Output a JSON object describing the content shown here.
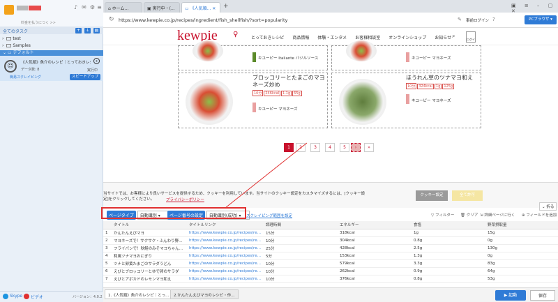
{
  "sidebar": {
    "subtitle": "料金を払うにつく >>",
    "task_header": "全てのタスク",
    "folders": [
      "test",
      "Samples"
    ],
    "default_folder": "デフォルト",
    "task": {
      "title": "《人気順》魚介のレシピ｜とっておきレシ...",
      "count_label": "データ数: 8",
      "status": "実行中",
      "mode": "簡易スクレイピング",
      "speed_button": "スピードアップ"
    },
    "footer": {
      "skype": "Skype",
      "video": "ビデオ",
      "version": "バージョン：4.0.2"
    }
  },
  "tabs": [
    {
      "label": "ホーム..."
    },
    {
      "label": "実行中・(..."
    },
    {
      "label": "《人気順..."
    }
  ],
  "url": "https://www.kewpie.co.jp/recipes/ingredient/fish_shellfish/?sort=popularity",
  "header_right": {
    "login": "事前ログイン",
    "browser": "PCブラウザ"
  },
  "site": {
    "logo": "kewpie",
    "nav": [
      "とっておきレシピ",
      "商品情報",
      "体験・エンタメ",
      "お客様相談室",
      "オンラインショップ",
      "お知らせ"
    ],
    "login": "ログイン",
    "cards": [
      {
        "title": "",
        "product": "キユーピー Italiante バジルソース"
      },
      {
        "title": "",
        "product": "キユーピー マヨネーズ"
      },
      {
        "title": "ブロッコリーとたまごのマヨネーズ炒め",
        "time": "10分",
        "kcal": "246kcal",
        "salt": "1.1g",
        "veg": "65g",
        "product": "キユーピー マヨネーズ"
      },
      {
        "title": "ほうれん草のツナマヨ和え",
        "time": "10分",
        "kcal": "324kcal",
        "salt": "1g",
        "veg": "125g",
        "product": "キユーピー マヨネーズ"
      }
    ],
    "pages": [
      "1",
      "2",
      "3",
      "4",
      "5",
      "»"
    ],
    "cookie_text": "当サイトでは、お客様により良いサービスを提供するため、クッキーを利用しています。当サイトのクッキー設定をカスタマイズするには、[クッキー設定]をクリックしてください。",
    "privacy": "プライバシーポリシー",
    "cookie_settings": "クッキー設定",
    "cookie_accept": "全て許可"
  },
  "tool": {
    "page_type_label": "ページタイプ",
    "page_type_value": "自動識別",
    "page_num_label": "ページ番号の設定",
    "page_num_value": "自動識別(成功)",
    "scroll_link": "スクレイピング範囲を設定",
    "collapse": "折る",
    "filter": "フィルター",
    "clear": "クリア",
    "detail": "詳細ページに行く",
    "add_field": "フィールドを追加"
  },
  "table": {
    "columns": [
      "タイトル",
      "タイトルリンク",
      "調理時間",
      "エネルギー",
      "食塩",
      "野菜摂取量"
    ],
    "rows": [
      [
        "かんたんえびマヨ",
        "https://www.kewpie.co.jp/recipes/recipe/QP...",
        "15分",
        "318kcal",
        "1g",
        "15g"
      ],
      [
        "マヨネーズで！サクサク・ふんわり野菜の...",
        "https://www.kewpie.co.jp/recipes/recipe/QP...",
        "10分",
        "304kcal",
        "0.8g",
        "0g"
      ],
      [
        "フライパンで！秋鮭のみそマヨちゃんちゃん...",
        "https://www.kewpie.co.jp/recipes/recipe/QP...",
        "25分",
        "428kcal",
        "2.5g",
        "130g"
      ],
      [
        "和風ツナマヨおにぎり",
        "https://www.kewpie.co.jp/recipes/recipe/QP...",
        "5分",
        "153kcal",
        "1.3g",
        "0g"
      ],
      [
        "ツナと卵黄たまごのサラダうどん",
        "https://www.kewpie.co.jp/recipes/recipe/QP...",
        "10分",
        "579kcal",
        "3.3g",
        "83g"
      ],
      [
        "えびとブロッコリーとゆで卵のサラダ",
        "https://www.kewpie.co.jp/recipes/recipe/QP...",
        "10分",
        "262kcal",
        "0.9g",
        "64g"
      ],
      [
        "えびとアボカドのレモンマヨ和え",
        "https://www.kewpie.co.jp/recipes/recipe/QP...",
        "10分",
        "376kcal",
        "0.8g",
        "53g"
      ]
    ]
  },
  "statusbar": {
    "tabs": [
      "1.《人気順》魚介のレシピ｜とっ...",
      "2.かんたんえびマヨのレシピ・作..."
    ],
    "start": "▶ 起動",
    "save": "保存"
  },
  "colors": {
    "accent": "#2f7bd6",
    "kewpie_red": "#c8112c",
    "highlight": "#e03030"
  }
}
